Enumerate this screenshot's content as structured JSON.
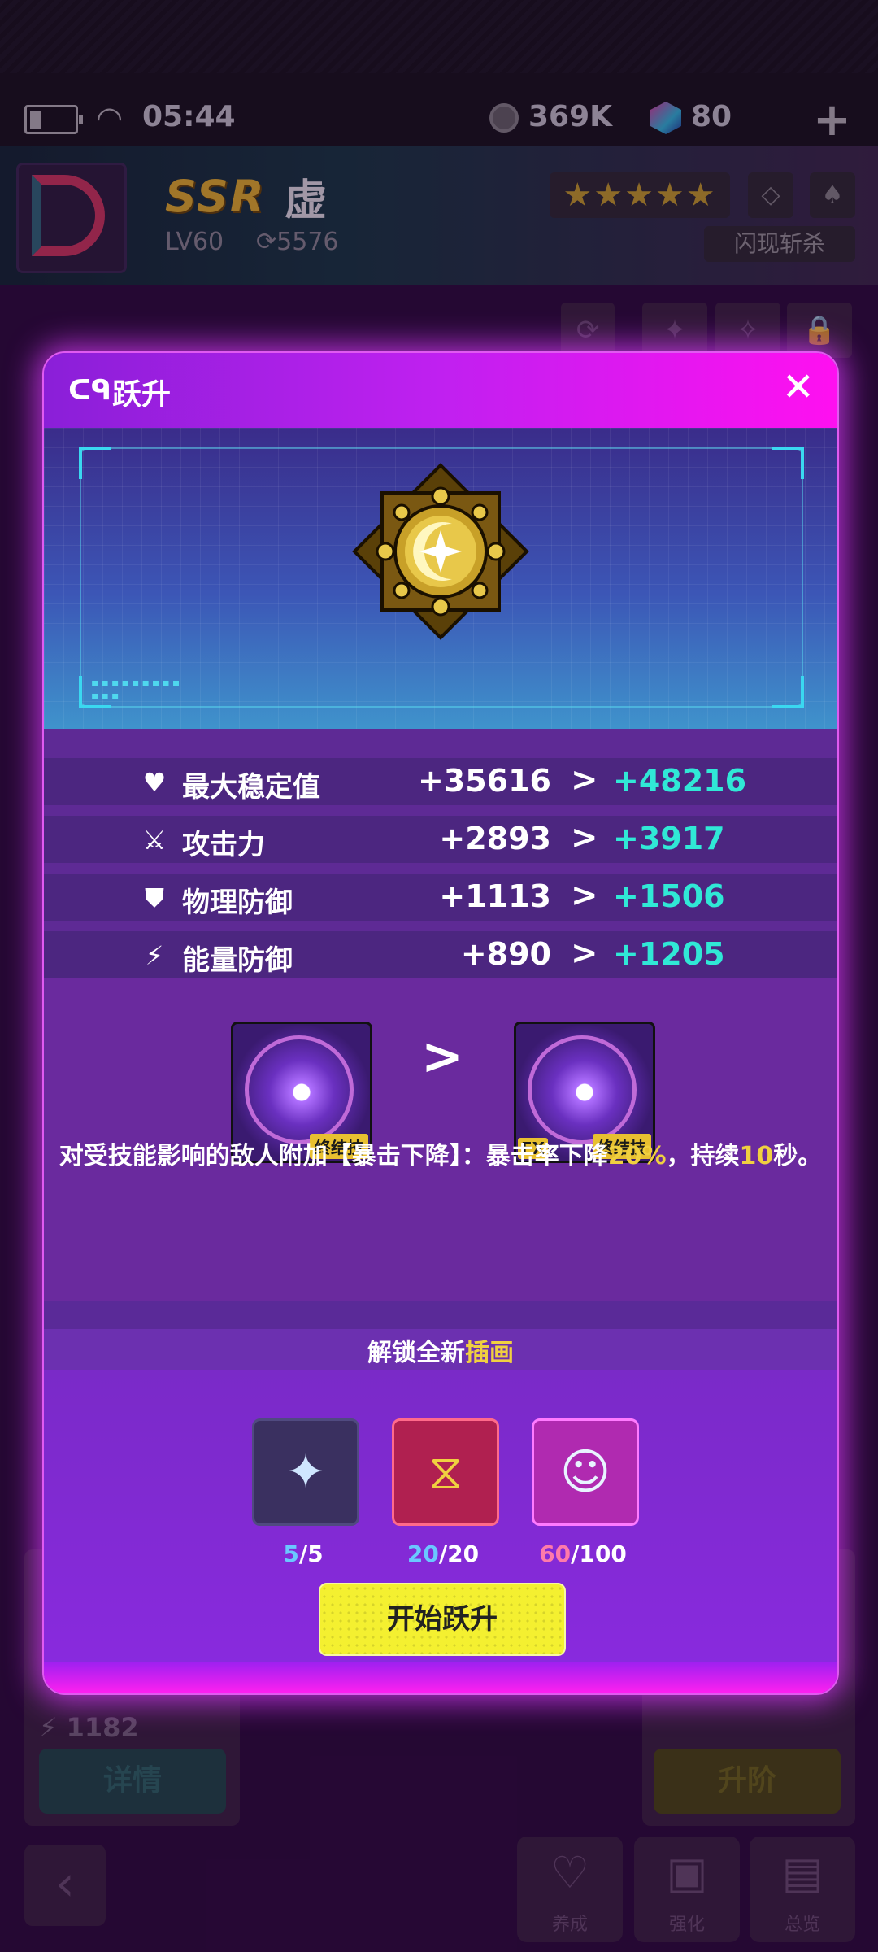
{
  "status_bar": {
    "time": "05:44",
    "coins": "369K",
    "gems": "80"
  },
  "character": {
    "rarity": "SSR",
    "name": "虚",
    "level": "LV60",
    "power": "5576",
    "skill_name": "闪现斩杀",
    "stars": "★★★★★"
  },
  "modal": {
    "title": "跃升",
    "close_glyph": "✕",
    "stats": [
      {
        "name": "最大稳定值",
        "old": "+35616",
        "new": "+48216",
        "icon": "heart-pulse-icon"
      },
      {
        "name": "攻击力",
        "old": "+2893",
        "new": "+3917",
        "icon": "sword-icon"
      },
      {
        "name": "物理防御",
        "old": "+1113",
        "new": "+1506",
        "icon": "shield-exclaim-icon"
      },
      {
        "name": "能量防御",
        "old": "+890",
        "new": "+1205",
        "icon": "shield-bolt-icon"
      }
    ],
    "arrow": ">",
    "skill": {
      "tag": "终结技",
      "ex_tag": "EX",
      "desc_prefix": "对受技能影响的敌人附加【暴击下降】：暴击率下降",
      "desc_val1": "20%",
      "desc_mid": "，持续",
      "desc_val2": "10",
      "desc_suffix": "秒。"
    },
    "unlock": {
      "prefix": "解锁全新",
      "highlight": "插画"
    },
    "materials": [
      {
        "have": "5",
        "need": "/5",
        "icon": "sparkle-stone-icon"
      },
      {
        "have": "20",
        "need": "/20",
        "icon": "crystal-core-icon"
      },
      {
        "have": "60",
        "need": "/100",
        "icon": "portrait-chip-icon"
      }
    ],
    "start_button": "开始跃升"
  },
  "background": {
    "left_value": "1182",
    "details_button": "详情",
    "upgrade_button": "升阶",
    "nav": [
      "养成",
      "强化",
      "总览"
    ]
  },
  "colors": {
    "accent_new": "#30e8d6",
    "highlight": "#f0d040",
    "modal_glow": "#e05af0",
    "start_button": "#f4f030"
  }
}
